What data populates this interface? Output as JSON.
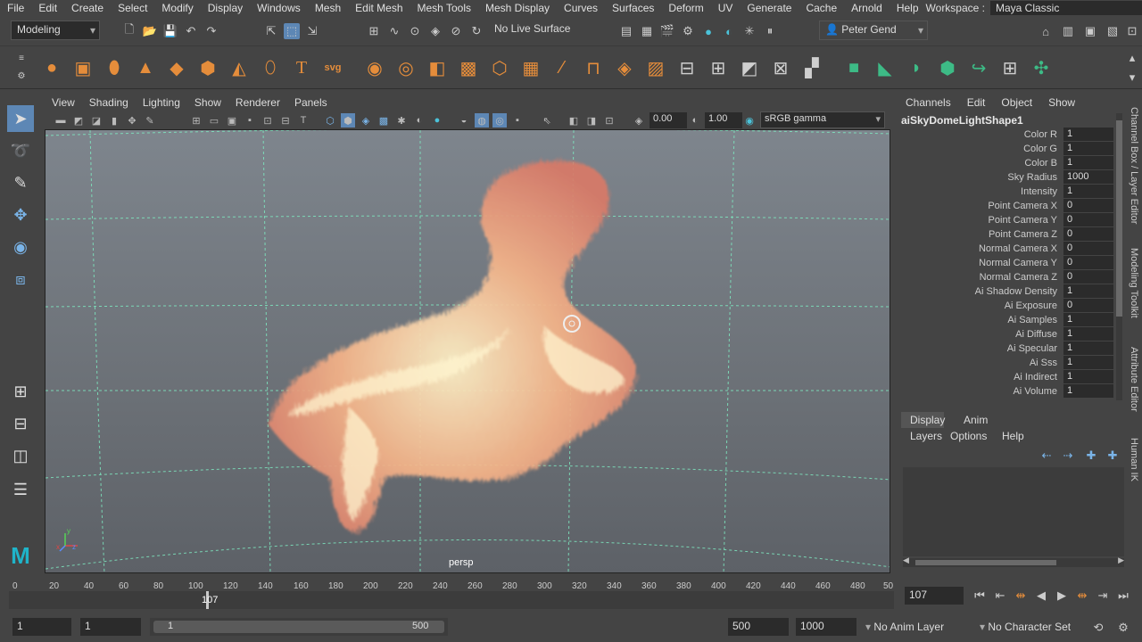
{
  "menubar": {
    "items": [
      "File",
      "Edit",
      "Create",
      "Select",
      "Modify",
      "Display",
      "Windows",
      "Mesh",
      "Edit Mesh",
      "Mesh Tools",
      "Mesh Display",
      "Curves",
      "Surfaces",
      "Deform",
      "UV",
      "Generate",
      "Cache",
      "Arnold",
      "Help"
    ],
    "workspace_label": "Workspace :",
    "workspace_value": "Maya Classic"
  },
  "status": {
    "mode": "Modeling",
    "live_surface": "No Live Surface",
    "user": "Peter Gend"
  },
  "viewport": {
    "menus": [
      "View",
      "Shading",
      "Lighting",
      "Show",
      "Renderer",
      "Panels"
    ],
    "exposure": "0.00",
    "gamma": "1.00",
    "colorspace": "sRGB gamma",
    "camera": "persp"
  },
  "channelbox": {
    "menus": [
      "Channels",
      "Edit",
      "Object",
      "Show"
    ],
    "node": "aiSkyDomeLightShape1",
    "attrs": [
      {
        "name": "Color R",
        "value": "1"
      },
      {
        "name": "Color G",
        "value": "1"
      },
      {
        "name": "Color B",
        "value": "1"
      },
      {
        "name": "Sky Radius",
        "value": "1000"
      },
      {
        "name": "Intensity",
        "value": "1"
      },
      {
        "name": "Point Camera X",
        "value": "0"
      },
      {
        "name": "Point Camera Y",
        "value": "0"
      },
      {
        "name": "Point Camera Z",
        "value": "0"
      },
      {
        "name": "Normal Camera X",
        "value": "0"
      },
      {
        "name": "Normal Camera Y",
        "value": "0"
      },
      {
        "name": "Normal Camera Z",
        "value": "0"
      },
      {
        "name": "Ai Shadow Density",
        "value": "1"
      },
      {
        "name": "Ai Exposure",
        "value": "0"
      },
      {
        "name": "Ai Samples",
        "value": "1"
      },
      {
        "name": "Ai Diffuse",
        "value": "1"
      },
      {
        "name": "Ai Specular",
        "value": "1"
      },
      {
        "name": "Ai Sss",
        "value": "1"
      },
      {
        "name": "Ai Indirect",
        "value": "1"
      },
      {
        "name": "Ai Volume",
        "value": "1"
      }
    ]
  },
  "sidetabs": [
    "Channel Box / Layer Editor",
    "Modeling Toolkit",
    "Attribute Editor",
    "Human IK"
  ],
  "layers": {
    "tabs": [
      "Display",
      "Anim"
    ],
    "menus": [
      "Layers",
      "Options",
      "Help"
    ]
  },
  "timeline": {
    "ticks": [
      "0",
      "20",
      "40",
      "60",
      "80",
      "100",
      "120",
      "140",
      "160",
      "180",
      "200",
      "220",
      "240",
      "260",
      "280",
      "300",
      "320",
      "340",
      "360",
      "380",
      "400",
      "420",
      "440",
      "460",
      "480",
      "50"
    ],
    "current_label": "107",
    "current_frame": "107"
  },
  "range": {
    "start": "1",
    "playback_start": "1",
    "slider_start": "1",
    "slider_end": "500",
    "playback_end": "500",
    "end": "1000",
    "anim_layer": "No Anim Layer",
    "char_set": "No Character Set"
  },
  "colors": {
    "accent": "#5d87b5",
    "grid": "#7ee8c0",
    "fur": "#f2a27c"
  }
}
